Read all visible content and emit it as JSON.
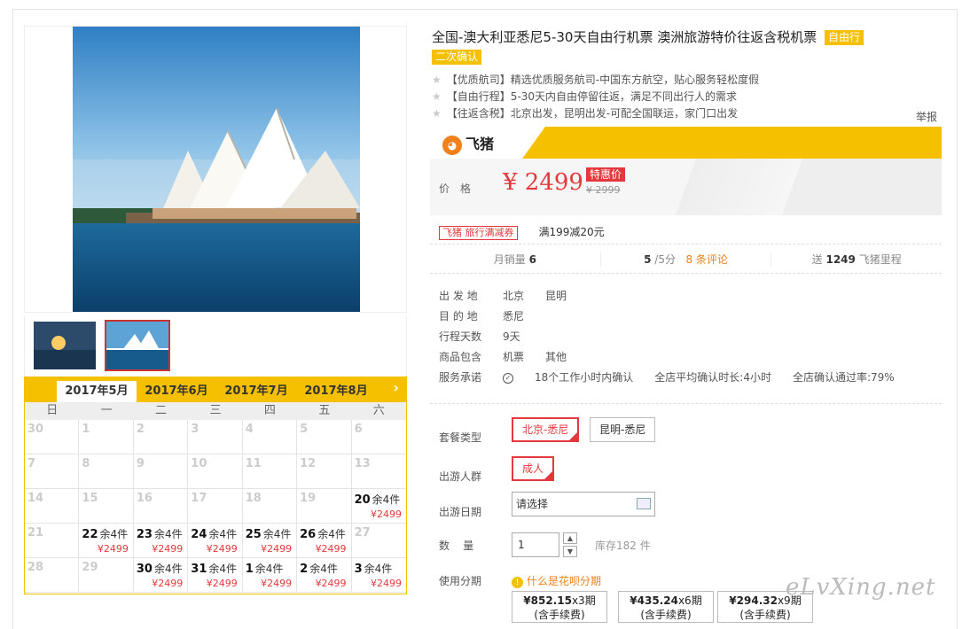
{
  "product": {
    "title": "全国-澳大利亚悉尼5-30天自由行机票 澳洲旅游特价往返含税机票",
    "tags": [
      "自由行",
      "二次确认"
    ],
    "features": [
      "【优质航司】精选优质服务航司-中国东方航空，贴心服务轻松度假",
      "【自由行程】5-30天内自由停留往返，满足不同出行人的需求",
      "【往返含税】北京出发，昆明出发-可配全国联运，家门口出发"
    ],
    "report_label": "举报"
  },
  "brand": {
    "name": "飞猪",
    "icon": "pig-logo-icon"
  },
  "price": {
    "label": "价格",
    "current": "¥ 2499",
    "special_tag": "特惠价",
    "original": "¥ 2999"
  },
  "coupon": {
    "tag": "飞猪 旅行满减券",
    "text": "满199减20元"
  },
  "stats": {
    "monthly_sales_label": "月销量",
    "monthly_sales": "6",
    "rating": "5",
    "rating_suffix": "/5分",
    "reviews": "8 条评论",
    "points_prefix": "送",
    "points": "1249",
    "points_suffix": "飞猪里程"
  },
  "info": [
    {
      "label": "出 发 地",
      "values": [
        "北京",
        "昆明"
      ]
    },
    {
      "label": "目 的 地",
      "values": [
        "悉尼"
      ]
    },
    {
      "label": "行程天数",
      "values": [
        "9天"
      ]
    },
    {
      "label": "商品包含",
      "values": [
        "机票",
        "其他"
      ]
    },
    {
      "label": "服务承诺",
      "values": [
        "18个工作小时内确认",
        "全店平均确认时长:4小时",
        "全店确认通过率:79%"
      ]
    }
  ],
  "options": {
    "package_label": "套餐类型",
    "packages": [
      "北京-悉尼",
      "昆明-悉尼"
    ],
    "traveler_label": "出游人群",
    "travelers": [
      "成人"
    ],
    "date_label": "出游日期",
    "date_placeholder": "请选择",
    "qty_label": "数    量",
    "qty": "1",
    "stock": "库存182 件",
    "installment_label": "使用分期",
    "huabei": "什么是花呗分期",
    "installments": [
      {
        "amount": "¥852.15",
        "periods": "x3期",
        "fee": "(含手续费)"
      },
      {
        "amount": "¥435.24",
        "periods": "x6期",
        "fee": "(含手续费)"
      },
      {
        "amount": "¥294.32",
        "periods": "x9期",
        "fee": "(含手续费)"
      }
    ]
  },
  "calendar": {
    "months": [
      "2017年5月",
      "2017年6月",
      "2017年7月",
      "2017年8月"
    ],
    "active_month": "2017年5月",
    "weekdays": [
      "日",
      "一",
      "二",
      "三",
      "四",
      "五",
      "六"
    ],
    "days": [
      {
        "d": "30"
      },
      {
        "d": "1"
      },
      {
        "d": "2"
      },
      {
        "d": "3"
      },
      {
        "d": "4"
      },
      {
        "d": "5"
      },
      {
        "d": "6"
      },
      {
        "d": "7"
      },
      {
        "d": "8"
      },
      {
        "d": "9"
      },
      {
        "d": "10"
      },
      {
        "d": "11"
      },
      {
        "d": "12"
      },
      {
        "d": "13"
      },
      {
        "d": "14"
      },
      {
        "d": "15"
      },
      {
        "d": "16"
      },
      {
        "d": "17"
      },
      {
        "d": "18"
      },
      {
        "d": "19"
      },
      {
        "d": "20",
        "stock": "余4件",
        "price": "¥2499"
      },
      {
        "d": "21"
      },
      {
        "d": "22",
        "stock": "余4件",
        "price": "¥2499"
      },
      {
        "d": "23",
        "stock": "余4件",
        "price": "¥2499"
      },
      {
        "d": "24",
        "stock": "余4件",
        "price": "¥2499"
      },
      {
        "d": "25",
        "stock": "余4件",
        "price": "¥2499"
      },
      {
        "d": "26",
        "stock": "余4件",
        "price": "¥2499"
      },
      {
        "d": "27"
      },
      {
        "d": "28"
      },
      {
        "d": "29"
      },
      {
        "d": "30",
        "stock": "余4件",
        "price": "¥2499"
      },
      {
        "d": "31",
        "stock": "余4件",
        "price": "¥2499"
      },
      {
        "d": "1",
        "stock": "余4件",
        "price": "¥2499"
      },
      {
        "d": "2",
        "stock": "余4件",
        "price": "¥2499"
      },
      {
        "d": "3",
        "stock": "余4件",
        "price": "¥2499"
      }
    ]
  },
  "watermark": "eLvXing.net",
  "colors": {
    "accent": "#f5c000",
    "price": "#e4393c",
    "orange": "#f08019"
  }
}
